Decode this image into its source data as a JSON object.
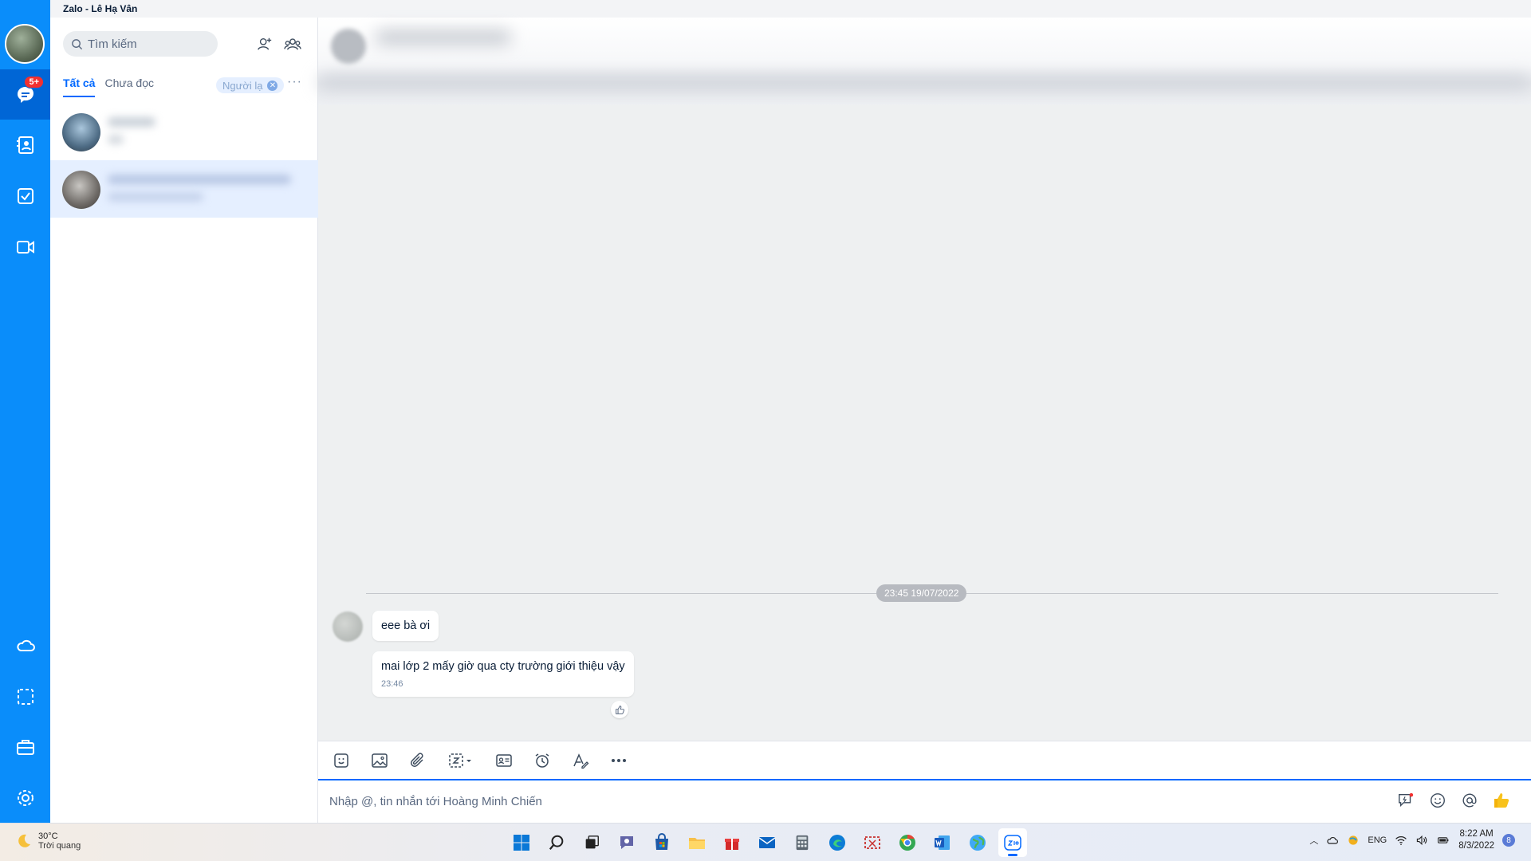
{
  "window": {
    "title": "Zalo - Lê Hạ Vân"
  },
  "rail": {
    "chat_badge": "5+"
  },
  "sidebar": {
    "search_placeholder": "Tìm kiếm",
    "tabs": [
      "Tất cả",
      "Chưa đọc"
    ],
    "filter_chip": "Người lạ",
    "more": "···"
  },
  "chat": {
    "date_separator": "23:45 19/07/2022",
    "messages": [
      {
        "text": "eee bà ơi"
      },
      {
        "text": "mai lớp 2 mấy giờ qua cty trường giới thiệu vậy",
        "time": "23:46"
      }
    ],
    "composer_placeholder": "Nhập @, tin nhắn tới Hoàng Minh Chiến"
  },
  "taskbar": {
    "weather_temp": "30°C",
    "weather_cond": "Trời quang",
    "lang": "ENG",
    "time": "8:22 AM",
    "date": "8/3/2022",
    "notif_count": "8"
  },
  "colors": {
    "rail": "#0a8dfa",
    "accent": "#0068ff",
    "badge": "#f23030"
  }
}
